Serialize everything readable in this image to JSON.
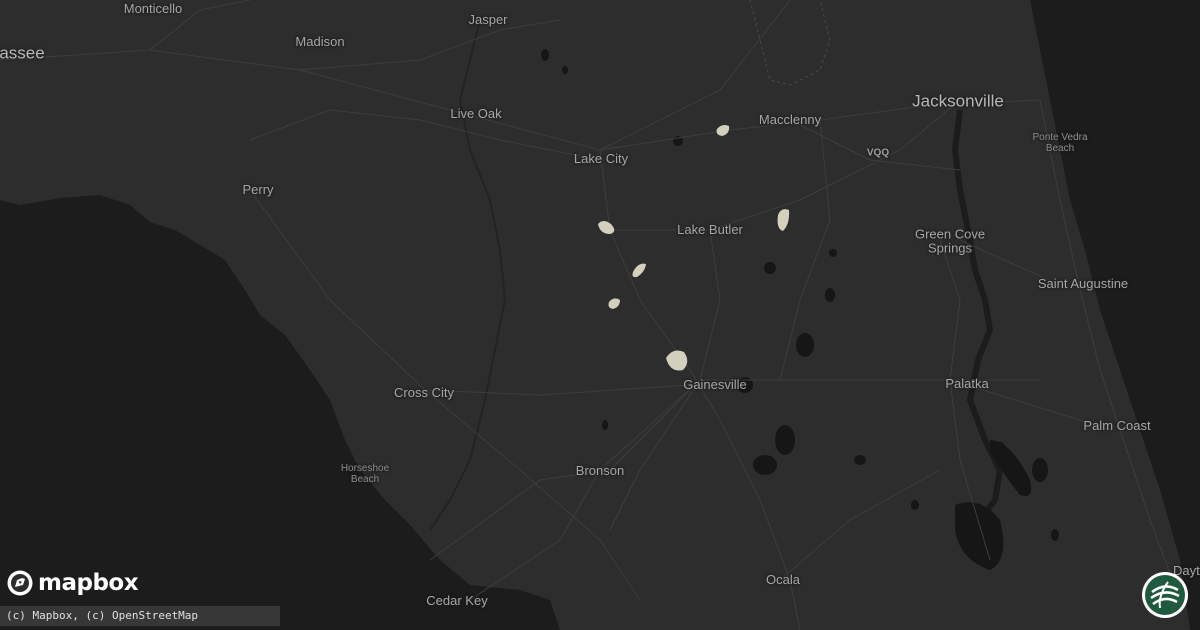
{
  "map": {
    "theme": "dark",
    "land_color": "#2d2d2d",
    "water_color": "#1c1c1c",
    "road_color": "#3d3d3d",
    "lake_color": "#161616",
    "highlight_color": "#d3d0bd"
  },
  "places": [
    {
      "id": "monticello",
      "name": "Monticello",
      "class": "med"
    },
    {
      "id": "tallahassee",
      "name": "assee",
      "class": "big"
    },
    {
      "id": "madison",
      "name": "Madison",
      "class": "med"
    },
    {
      "id": "jasper",
      "name": "Jasper",
      "class": "med"
    },
    {
      "id": "live-oak",
      "name": "Live Oak",
      "class": "med"
    },
    {
      "id": "lake-city",
      "name": "Lake City",
      "class": "med"
    },
    {
      "id": "macclenny",
      "name": "Macclenny",
      "class": "med"
    },
    {
      "id": "jacksonville",
      "name": "Jacksonville",
      "class": "big"
    },
    {
      "id": "ponte-vedra",
      "name": "Ponte Vedra\nBeach",
      "class": "small"
    },
    {
      "id": "vqq",
      "name": "VQQ",
      "class": "code"
    },
    {
      "id": "perry",
      "name": "Perry",
      "class": "med"
    },
    {
      "id": "lake-butler",
      "name": "Lake Butler",
      "class": "med"
    },
    {
      "id": "green-cove",
      "name": "Green Cove\nSprings",
      "class": "med"
    },
    {
      "id": "saint-augustine",
      "name": "Saint Augustine",
      "class": "med"
    },
    {
      "id": "gainesville",
      "name": "Gainesville",
      "class": "med"
    },
    {
      "id": "cross-city",
      "name": "Cross City",
      "class": "med"
    },
    {
      "id": "palatka",
      "name": "Palatka",
      "class": "med"
    },
    {
      "id": "palm-coast",
      "name": "Palm Coast",
      "class": "med"
    },
    {
      "id": "horseshoe-beach",
      "name": "Horseshoe\nBeach",
      "class": "small"
    },
    {
      "id": "bronson",
      "name": "Bronson",
      "class": "med"
    },
    {
      "id": "ocala",
      "name": "Ocala",
      "class": "med"
    },
    {
      "id": "cedar-key",
      "name": "Cedar Key",
      "class": "med"
    },
    {
      "id": "daytona",
      "name": "Daytona B",
      "class": "med"
    }
  ],
  "branding": {
    "logo_text": "mapbox",
    "attribution": "(c) Mapbox, (c) OpenStreetMap"
  }
}
